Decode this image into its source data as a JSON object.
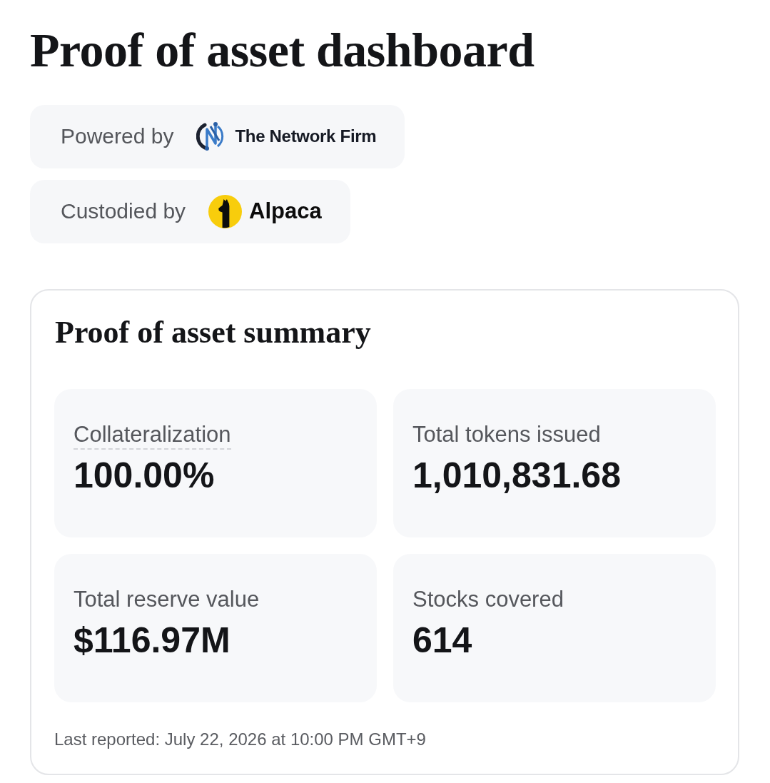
{
  "page": {
    "title": "Proof of asset dashboard"
  },
  "attributions": [
    {
      "label": "Powered by",
      "kind": "network",
      "name": "The Network Firm"
    },
    {
      "label": "Custodied by",
      "kind": "alpaca",
      "name": "Alpaca"
    }
  ],
  "summary": {
    "title": "Proof of asset summary",
    "stats": [
      {
        "label": "Collateralization",
        "value": "100.00%",
        "has_tooltip": true
      },
      {
        "label": "Total tokens issued",
        "value": "1,010,831.68",
        "has_tooltip": false
      },
      {
        "label": "Total reserve value",
        "value": "$116.97M",
        "has_tooltip": false
      },
      {
        "label": "Stocks covered",
        "value": "614",
        "has_tooltip": false
      }
    ],
    "footer": "Last reported: July 22, 2026 at 10:00 PM GMT+9"
  }
}
